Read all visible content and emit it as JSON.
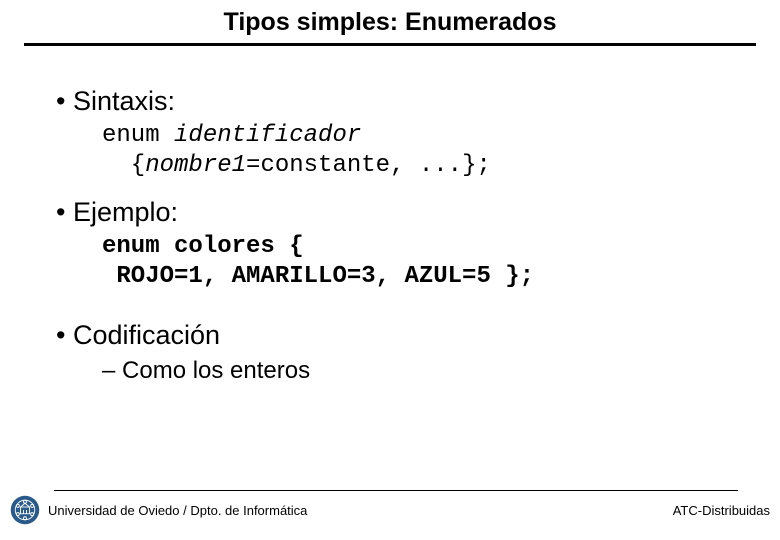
{
  "title": "Tipos simples: Enumerados",
  "bullets": {
    "sintaxis": {
      "label": "Sintaxis:",
      "code_kw": "enum ",
      "code_ident": "identificador",
      "code_line2a": "  {",
      "code_line2b": "nombre1",
      "code_line2c": "=constante, ...};"
    },
    "ejemplo": {
      "label": "Ejemplo:",
      "code_line1": "enum colores {",
      "code_line2": " ROJO=1, AMARILLO=3, AZUL=5 };"
    },
    "codificacion": {
      "label": "Codificación",
      "sub1": "Como los enteros"
    }
  },
  "footer": {
    "left": "Universidad de Oviedo / Dpto. de Informática",
    "right": "ATC-Distribuidas"
  }
}
